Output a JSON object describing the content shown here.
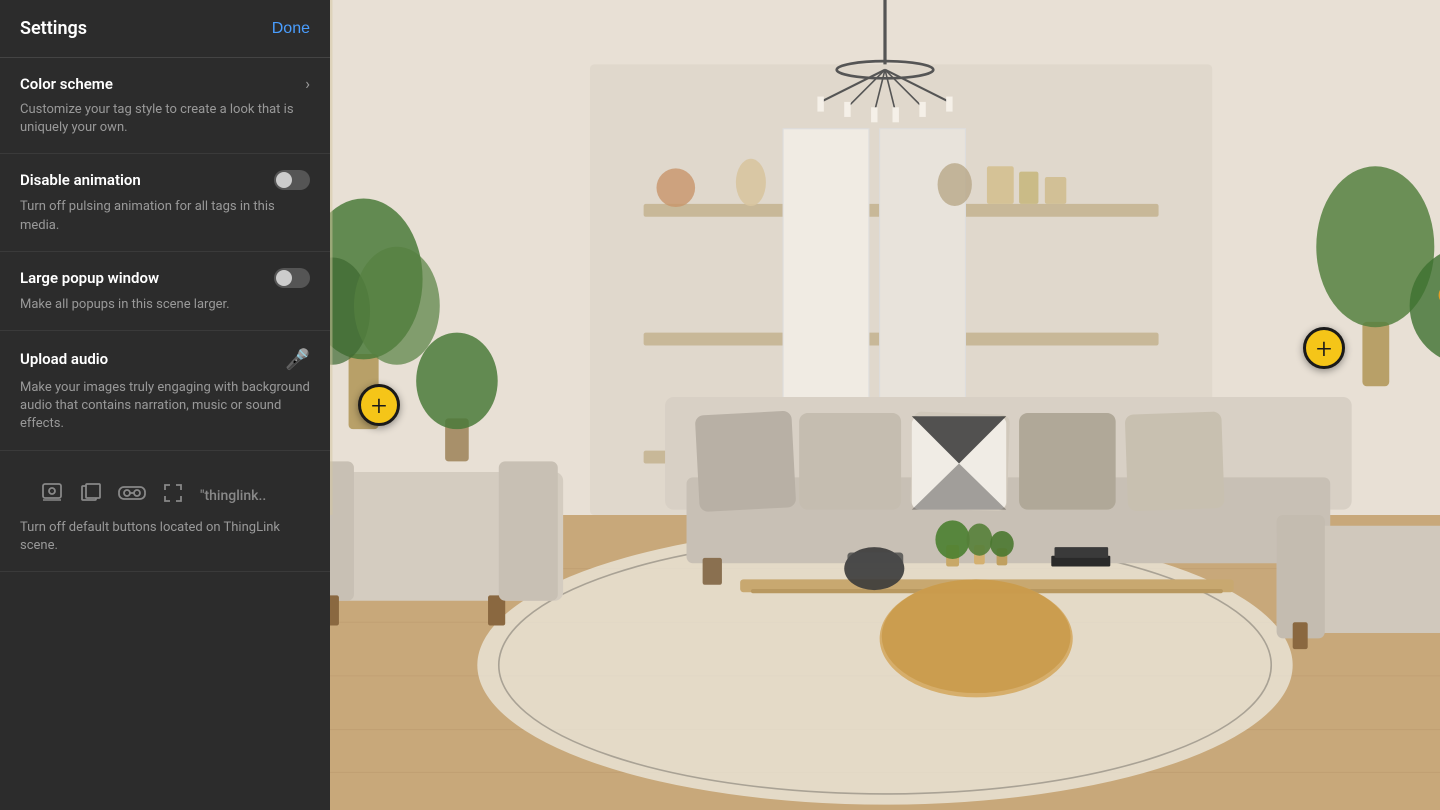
{
  "header": {
    "settings_title": "Settings",
    "done_label": "Done"
  },
  "settings": {
    "color_scheme": {
      "title": "Color scheme",
      "description": "Customize your tag style to create a look that is uniquely your own."
    },
    "disable_animation": {
      "title": "Disable animation",
      "description": "Turn off pulsing animation for all tags in this media.",
      "enabled": false
    },
    "large_popup": {
      "title": "Large popup window",
      "description": "Make all popups in this scene larger.",
      "enabled": false
    },
    "upload_audio": {
      "title": "Upload audio",
      "description": "Make your images truly engaging with background audio that contains narration, music or sound effects."
    },
    "toolbar": {
      "description": "Turn off default buttons located on ThingLink scene."
    }
  },
  "tags": [
    {
      "id": "tag-left",
      "symbol": "+"
    },
    {
      "id": "tag-right",
      "symbol": "+"
    }
  ],
  "bottom_bar": {
    "thinglink_label": "\"thinglink..."
  },
  "toolbar_label": "\"thinglink.."
}
